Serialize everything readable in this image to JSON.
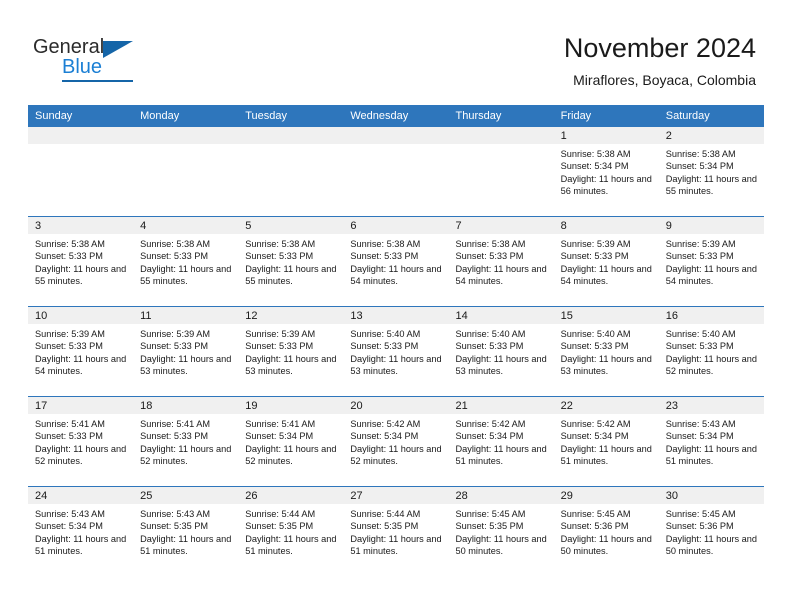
{
  "logo": {
    "word_top": "General",
    "word_bottom": "Blue",
    "triangle_icon": "triangle-icon",
    "colors": {
      "dark": "#2b2b2b",
      "blue": "#1b7fd4",
      "triangle": "#1565a8"
    }
  },
  "header": {
    "title": "November 2024",
    "subtitle": "Miraflores, Boyaca, Colombia"
  },
  "theme": {
    "header_bg": "#2e76bc",
    "header_text": "#ffffff",
    "day_band_bg": "#f0f0f0",
    "cell_bg": "#ffffff",
    "text": "#1a1a1a"
  },
  "weekdays": [
    "Sunday",
    "Monday",
    "Tuesday",
    "Wednesday",
    "Thursday",
    "Friday",
    "Saturday"
  ],
  "weeks": [
    [
      {
        "day": "",
        "empty": true
      },
      {
        "day": "",
        "empty": true
      },
      {
        "day": "",
        "empty": true
      },
      {
        "day": "",
        "empty": true
      },
      {
        "day": "",
        "empty": true
      },
      {
        "day": "1",
        "sunrise": "Sunrise: 5:38 AM",
        "sunset": "Sunset: 5:34 PM",
        "daylight": "Daylight: 11 hours and 56 minutes."
      },
      {
        "day": "2",
        "sunrise": "Sunrise: 5:38 AM",
        "sunset": "Sunset: 5:34 PM",
        "daylight": "Daylight: 11 hours and 55 minutes."
      }
    ],
    [
      {
        "day": "3",
        "sunrise": "Sunrise: 5:38 AM",
        "sunset": "Sunset: 5:33 PM",
        "daylight": "Daylight: 11 hours and 55 minutes."
      },
      {
        "day": "4",
        "sunrise": "Sunrise: 5:38 AM",
        "sunset": "Sunset: 5:33 PM",
        "daylight": "Daylight: 11 hours and 55 minutes."
      },
      {
        "day": "5",
        "sunrise": "Sunrise: 5:38 AM",
        "sunset": "Sunset: 5:33 PM",
        "daylight": "Daylight: 11 hours and 55 minutes."
      },
      {
        "day": "6",
        "sunrise": "Sunrise: 5:38 AM",
        "sunset": "Sunset: 5:33 PM",
        "daylight": "Daylight: 11 hours and 54 minutes."
      },
      {
        "day": "7",
        "sunrise": "Sunrise: 5:38 AM",
        "sunset": "Sunset: 5:33 PM",
        "daylight": "Daylight: 11 hours and 54 minutes."
      },
      {
        "day": "8",
        "sunrise": "Sunrise: 5:39 AM",
        "sunset": "Sunset: 5:33 PM",
        "daylight": "Daylight: 11 hours and 54 minutes."
      },
      {
        "day": "9",
        "sunrise": "Sunrise: 5:39 AM",
        "sunset": "Sunset: 5:33 PM",
        "daylight": "Daylight: 11 hours and 54 minutes."
      }
    ],
    [
      {
        "day": "10",
        "sunrise": "Sunrise: 5:39 AM",
        "sunset": "Sunset: 5:33 PM",
        "daylight": "Daylight: 11 hours and 54 minutes."
      },
      {
        "day": "11",
        "sunrise": "Sunrise: 5:39 AM",
        "sunset": "Sunset: 5:33 PM",
        "daylight": "Daylight: 11 hours and 53 minutes."
      },
      {
        "day": "12",
        "sunrise": "Sunrise: 5:39 AM",
        "sunset": "Sunset: 5:33 PM",
        "daylight": "Daylight: 11 hours and 53 minutes."
      },
      {
        "day": "13",
        "sunrise": "Sunrise: 5:40 AM",
        "sunset": "Sunset: 5:33 PM",
        "daylight": "Daylight: 11 hours and 53 minutes."
      },
      {
        "day": "14",
        "sunrise": "Sunrise: 5:40 AM",
        "sunset": "Sunset: 5:33 PM",
        "daylight": "Daylight: 11 hours and 53 minutes."
      },
      {
        "day": "15",
        "sunrise": "Sunrise: 5:40 AM",
        "sunset": "Sunset: 5:33 PM",
        "daylight": "Daylight: 11 hours and 53 minutes."
      },
      {
        "day": "16",
        "sunrise": "Sunrise: 5:40 AM",
        "sunset": "Sunset: 5:33 PM",
        "daylight": "Daylight: 11 hours and 52 minutes."
      }
    ],
    [
      {
        "day": "17",
        "sunrise": "Sunrise: 5:41 AM",
        "sunset": "Sunset: 5:33 PM",
        "daylight": "Daylight: 11 hours and 52 minutes."
      },
      {
        "day": "18",
        "sunrise": "Sunrise: 5:41 AM",
        "sunset": "Sunset: 5:33 PM",
        "daylight": "Daylight: 11 hours and 52 minutes."
      },
      {
        "day": "19",
        "sunrise": "Sunrise: 5:41 AM",
        "sunset": "Sunset: 5:34 PM",
        "daylight": "Daylight: 11 hours and 52 minutes."
      },
      {
        "day": "20",
        "sunrise": "Sunrise: 5:42 AM",
        "sunset": "Sunset: 5:34 PM",
        "daylight": "Daylight: 11 hours and 52 minutes."
      },
      {
        "day": "21",
        "sunrise": "Sunrise: 5:42 AM",
        "sunset": "Sunset: 5:34 PM",
        "daylight": "Daylight: 11 hours and 51 minutes."
      },
      {
        "day": "22",
        "sunrise": "Sunrise: 5:42 AM",
        "sunset": "Sunset: 5:34 PM",
        "daylight": "Daylight: 11 hours and 51 minutes."
      },
      {
        "day": "23",
        "sunrise": "Sunrise: 5:43 AM",
        "sunset": "Sunset: 5:34 PM",
        "daylight": "Daylight: 11 hours and 51 minutes."
      }
    ],
    [
      {
        "day": "24",
        "sunrise": "Sunrise: 5:43 AM",
        "sunset": "Sunset: 5:34 PM",
        "daylight": "Daylight: 11 hours and 51 minutes."
      },
      {
        "day": "25",
        "sunrise": "Sunrise: 5:43 AM",
        "sunset": "Sunset: 5:35 PM",
        "daylight": "Daylight: 11 hours and 51 minutes."
      },
      {
        "day": "26",
        "sunrise": "Sunrise: 5:44 AM",
        "sunset": "Sunset: 5:35 PM",
        "daylight": "Daylight: 11 hours and 51 minutes."
      },
      {
        "day": "27",
        "sunrise": "Sunrise: 5:44 AM",
        "sunset": "Sunset: 5:35 PM",
        "daylight": "Daylight: 11 hours and 51 minutes."
      },
      {
        "day": "28",
        "sunrise": "Sunrise: 5:45 AM",
        "sunset": "Sunset: 5:35 PM",
        "daylight": "Daylight: 11 hours and 50 minutes."
      },
      {
        "day": "29",
        "sunrise": "Sunrise: 5:45 AM",
        "sunset": "Sunset: 5:36 PM",
        "daylight": "Daylight: 11 hours and 50 minutes."
      },
      {
        "day": "30",
        "sunrise": "Sunrise: 5:45 AM",
        "sunset": "Sunset: 5:36 PM",
        "daylight": "Daylight: 11 hours and 50 minutes."
      }
    ]
  ]
}
